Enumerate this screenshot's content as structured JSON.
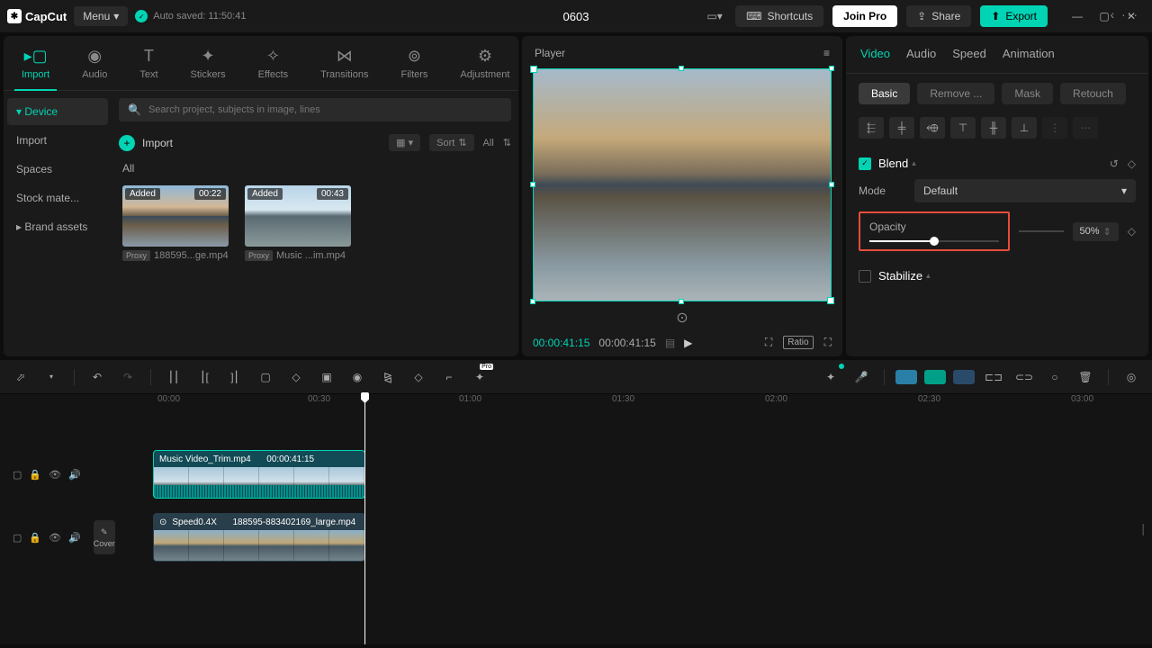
{
  "app": {
    "name": "CapCut",
    "menu": "Menu",
    "autosave": "Auto saved: 11:50:41",
    "project": "0603"
  },
  "topbar": {
    "shortcuts": "Shortcuts",
    "joinpro": "Join Pro",
    "share": "Share",
    "export": "Export"
  },
  "media": {
    "tabs": [
      "Import",
      "Audio",
      "Text",
      "Stickers",
      "Effects",
      "Transitions",
      "Filters",
      "Adjustment"
    ],
    "side": [
      "Device",
      "Import",
      "Spaces",
      "Stock mate...",
      "Brand assets"
    ],
    "search_placeholder": "Search project, subjects in image, lines",
    "import": "Import",
    "sort": "Sort",
    "all_btn": "All",
    "all_label": "All",
    "clips": [
      {
        "badge": "Added",
        "dur": "00:22",
        "proxy": "Proxy",
        "name": "188595...ge.mp4"
      },
      {
        "badge": "Added",
        "dur": "00:43",
        "proxy": "Proxy",
        "name": "Music ...im.mp4"
      }
    ]
  },
  "player": {
    "title": "Player",
    "current": "00:00:41:15",
    "total": "00:00:41:15",
    "ratio": "Ratio"
  },
  "props": {
    "tabs": [
      "Video",
      "Audio",
      "Speed",
      "Animation"
    ],
    "subtabs": [
      "Basic",
      "Remove ...",
      "Mask",
      "Retouch"
    ],
    "blend": {
      "title": "Blend",
      "mode_label": "Mode",
      "mode_value": "Default"
    },
    "opacity": {
      "label": "Opacity",
      "value": "50%"
    },
    "stabilize": {
      "title": "Stabilize"
    }
  },
  "timeline": {
    "ticks": [
      "00:00",
      "00:30",
      "01:00",
      "01:30",
      "02:00",
      "02:30",
      "03:00"
    ],
    "cover": "Cover",
    "clip1": {
      "name": "Music Video_Trim.mp4",
      "dur": "00:00:41:15"
    },
    "clip2": {
      "speed": "Speed0.4X",
      "name": "188595-883402169_large.mp4"
    }
  }
}
